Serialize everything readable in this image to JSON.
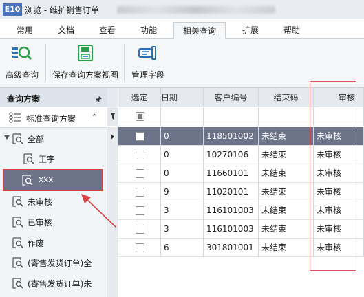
{
  "window": {
    "logo": "E10",
    "title": "浏览 - 维护销售订单"
  },
  "tabs": [
    {
      "label": "常用",
      "active": false
    },
    {
      "label": "文档",
      "active": false
    },
    {
      "label": "查看",
      "active": false
    },
    {
      "label": "功能",
      "active": false
    },
    {
      "label": "相关查询",
      "active": true
    },
    {
      "label": "扩展",
      "active": false
    },
    {
      "label": "帮助",
      "active": false
    }
  ],
  "ribbon": {
    "advanced_query": "高级查询",
    "save_view": "保存查询方案视图",
    "manage_fields": "管理字段"
  },
  "left_panel": {
    "header": "查询方案",
    "pin_icon": "pin-icon",
    "scheme": "标准查询方案",
    "tree": [
      {
        "label": "全部",
        "level": 0,
        "expandable": true
      },
      {
        "label": "王宇",
        "level": 1
      },
      {
        "label": "xxx",
        "level": 1,
        "selected": true
      },
      {
        "label": "未审核",
        "level": 0
      },
      {
        "label": "已审核",
        "level": 0
      },
      {
        "label": "作废",
        "level": 0
      },
      {
        "label": "(寄售发货订单)全",
        "level": 0
      },
      {
        "label": "(寄售发货订单)未",
        "level": 0
      }
    ]
  },
  "grid": {
    "columns": {
      "select": "选定",
      "date": "日期",
      "customer": "客户编号",
      "settle": "结束码",
      "audit": "审核"
    },
    "rows": [
      {
        "date": "0",
        "customer": "118501002",
        "settle": "未结束",
        "audit": "未审核",
        "active": true
      },
      {
        "date": "0",
        "customer": "10270106",
        "settle": "未结束",
        "audit": "未审核"
      },
      {
        "date": "0",
        "customer": "11660101",
        "settle": "未结束",
        "audit": "未审核"
      },
      {
        "date": "9",
        "customer": "11020101",
        "settle": "未结束",
        "audit": "未审核"
      },
      {
        "date": "3",
        "customer": "116101003",
        "settle": "未结束",
        "audit": "未审核"
      },
      {
        "date": "3",
        "customer": "116101003",
        "settle": "未结束",
        "audit": "未审核"
      },
      {
        "date": "6",
        "customer": "301801001",
        "settle": "未结束",
        "audit": "未审核"
      }
    ]
  },
  "colors": {
    "selection": "#6d7389",
    "highlight": "#d94040"
  }
}
